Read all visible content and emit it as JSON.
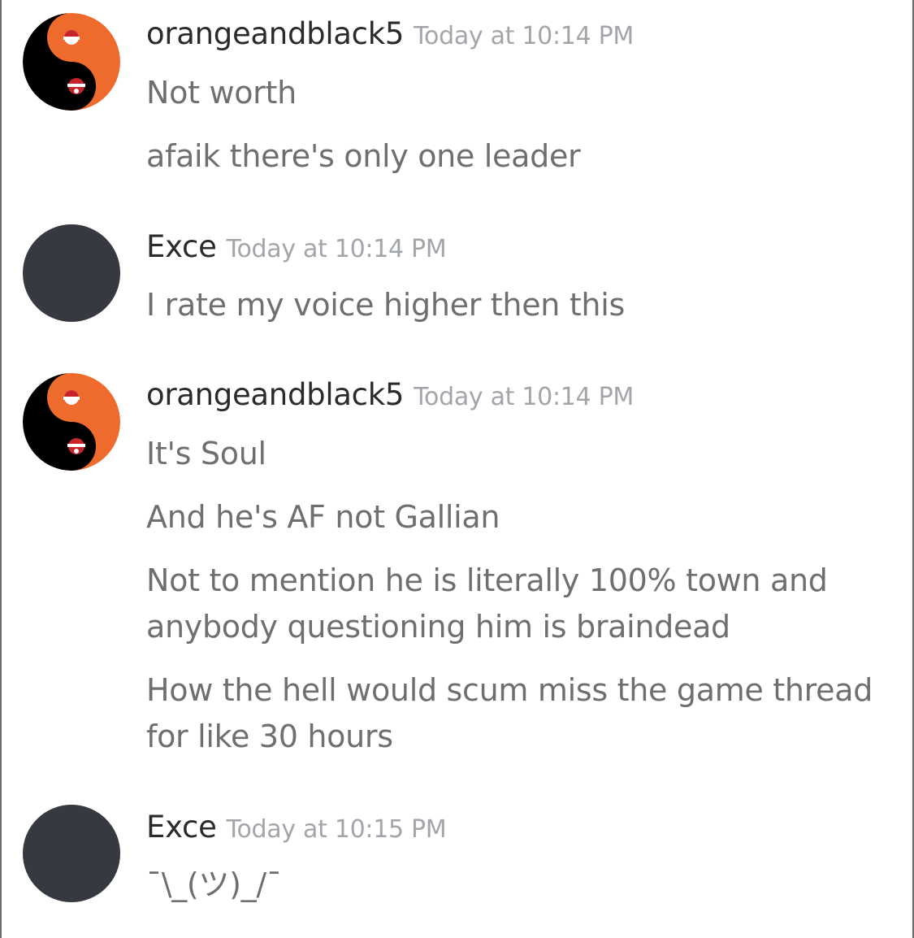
{
  "colors": {
    "username": "#2b2b2b",
    "timestamp": "#a2a6ab",
    "message": "#6e6f72",
    "avatar_orange": "#ee6a2d",
    "avatar_black": "#000000",
    "avatar_grey": "#36393f"
  },
  "groups": [
    {
      "author": "orangeandblack5",
      "timestamp": "Today at 10:14 PM",
      "avatar": "yin-yang-santa-avatar",
      "messages": [
        "Not worth",
        "afaik there's only one leader"
      ]
    },
    {
      "author": "Exce",
      "timestamp": "Today at 10:14 PM",
      "avatar": "default-grey-avatar",
      "messages": [
        "I rate my voice higher then this"
      ]
    },
    {
      "author": "orangeandblack5",
      "timestamp": "Today at 10:14 PM",
      "avatar": "yin-yang-santa-avatar",
      "messages": [
        "It's Soul",
        "And he's AF not Gallian",
        "Not to mention he is literally 100% town and anybody questioning him is braindead",
        "How the hell would scum miss the game thread for like 30 hours"
      ]
    },
    {
      "author": "Exce",
      "timestamp": "Today at 10:15 PM",
      "avatar": "default-grey-avatar",
      "messages": [
        "¯\\_(ツ)_/¯"
      ]
    }
  ]
}
